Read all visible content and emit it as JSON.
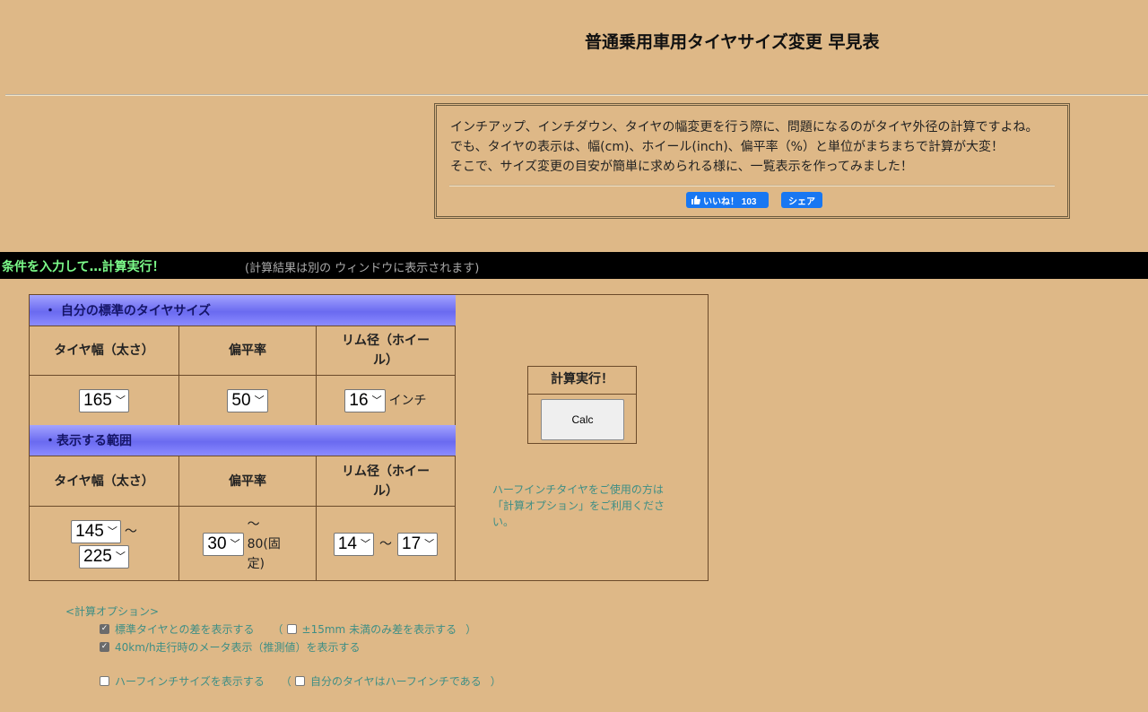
{
  "page_title": "普通乗用車用タイヤサイズ変更 早見表",
  "intro": {
    "line1": "インチアップ、インチダウン、タイヤの幅変更を行う際に、問題になるのがタイヤ外径の計算ですよね。",
    "line2": "でも、タイヤの表示は、幅(cm)、ホイール(inch)、偏平率（%）と単位がまちまちで計算が大変！",
    "line3": "そこで、サイズ変更の目安が簡単に求められる様に、一覧表示を作ってみました！",
    "like_label": "いいね！ 103",
    "share_label": "シェア"
  },
  "condition_bar": {
    "title": "条件を入力して…計算実行！",
    "note": "(計算結果は別の ウィンドウに表示されます)"
  },
  "standard_section": {
    "header": "・ 自分の標準のタイヤサイズ",
    "col_width": "タイヤ幅（太さ）",
    "col_aspect": "偏平率",
    "col_rim": "リム径（ホイール）",
    "width_value": "165",
    "aspect_value": "50",
    "rim_value": "16",
    "rim_unit": "インチ"
  },
  "range_section": {
    "header": "・表示する範囲",
    "col_width": "タイヤ幅（太さ）",
    "col_aspect": "偏平率",
    "col_rim": "リム径（ホイール）",
    "width_from": "145",
    "width_to": "225",
    "aspect_from": "30",
    "aspect_to_text": "〜 80(固定)",
    "rim_from": "14",
    "rim_to": "17",
    "tilde": "〜"
  },
  "calc": {
    "header": "計算実行！",
    "button": "Calc"
  },
  "half_inch_note": "ハーフインチタイヤをご使用の方は「計算オプション」をご利用ください。",
  "options": {
    "title": "<計算オプション>",
    "items": [
      {
        "label": "標準タイヤとの差を表示する",
        "checked": true
      },
      {
        "label": "±15mm 未満のみ差を表示する",
        "checked": false
      },
      {
        "label": "40km/h走行時のメータ表示（推測値）を表示する",
        "checked": true
      },
      {
        "label": "ハーフインチサイズを表示する",
        "checked": false
      },
      {
        "label": "自分のタイヤはハーフインチである",
        "checked": false
      }
    ],
    "paren_open": "（",
    "paren_close": "）"
  },
  "colors": {
    "background": "#deb887",
    "bar": "#000000",
    "bar_title": "#7cfc8a",
    "header_gradient": "#8c8cff",
    "teal_text": "#3e8e85",
    "facebook": "#1877f2"
  }
}
